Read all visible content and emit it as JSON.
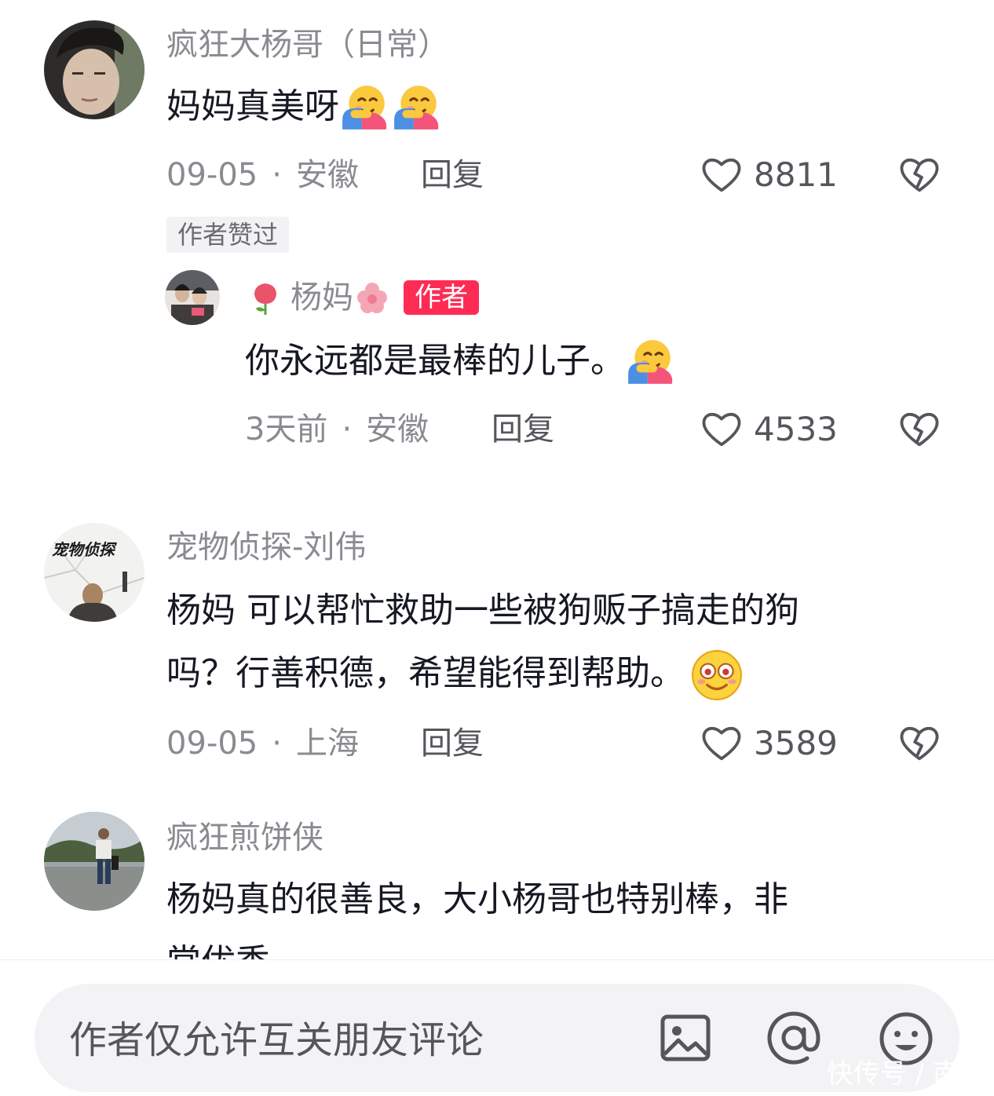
{
  "comments": [
    {
      "username": "疯狂大杨哥（日常）",
      "text": "妈妈真美呀",
      "date": "09-05",
      "location": "安徽",
      "reply_label": "回复",
      "likes": "8811",
      "tag": "作者赞过",
      "reply": {
        "username": "杨妈",
        "badge": "作者",
        "text": "你永远都是最棒的儿子。",
        "date": "3天前",
        "location": "安徽",
        "reply_label": "回复",
        "likes": "4533"
      }
    },
    {
      "username": "宠物侦探-刘伟",
      "avatar_text": "宠物侦探",
      "text_line1": "杨妈 可以帮忙救助一些被狗贩子搞走的狗",
      "text_line2": "吗？行善积德，希望能得到帮助。",
      "date": "09-05",
      "location": "上海",
      "reply_label": "回复",
      "likes": "3589"
    },
    {
      "username": "疯狂煎饼侠",
      "text_line1": "杨妈真的很善良，大小杨哥也特别棒，非",
      "text_line2": "常优秀"
    }
  ],
  "input": {
    "placeholder": "作者仅允许互关朋友评论"
  },
  "watermark": "快传号 / 南宫",
  "icons": [
    "heart-icon",
    "broken-heart-icon",
    "image-icon",
    "at-icon",
    "emoji-icon",
    "hug-emoji-icon",
    "rose-emoji-icon",
    "flower-emoji-icon",
    "smile-emoji-icon"
  ],
  "colors": {
    "author_badge": "#fe2c55",
    "secondary_text": "#8a8b91",
    "primary_text": "#161823"
  }
}
